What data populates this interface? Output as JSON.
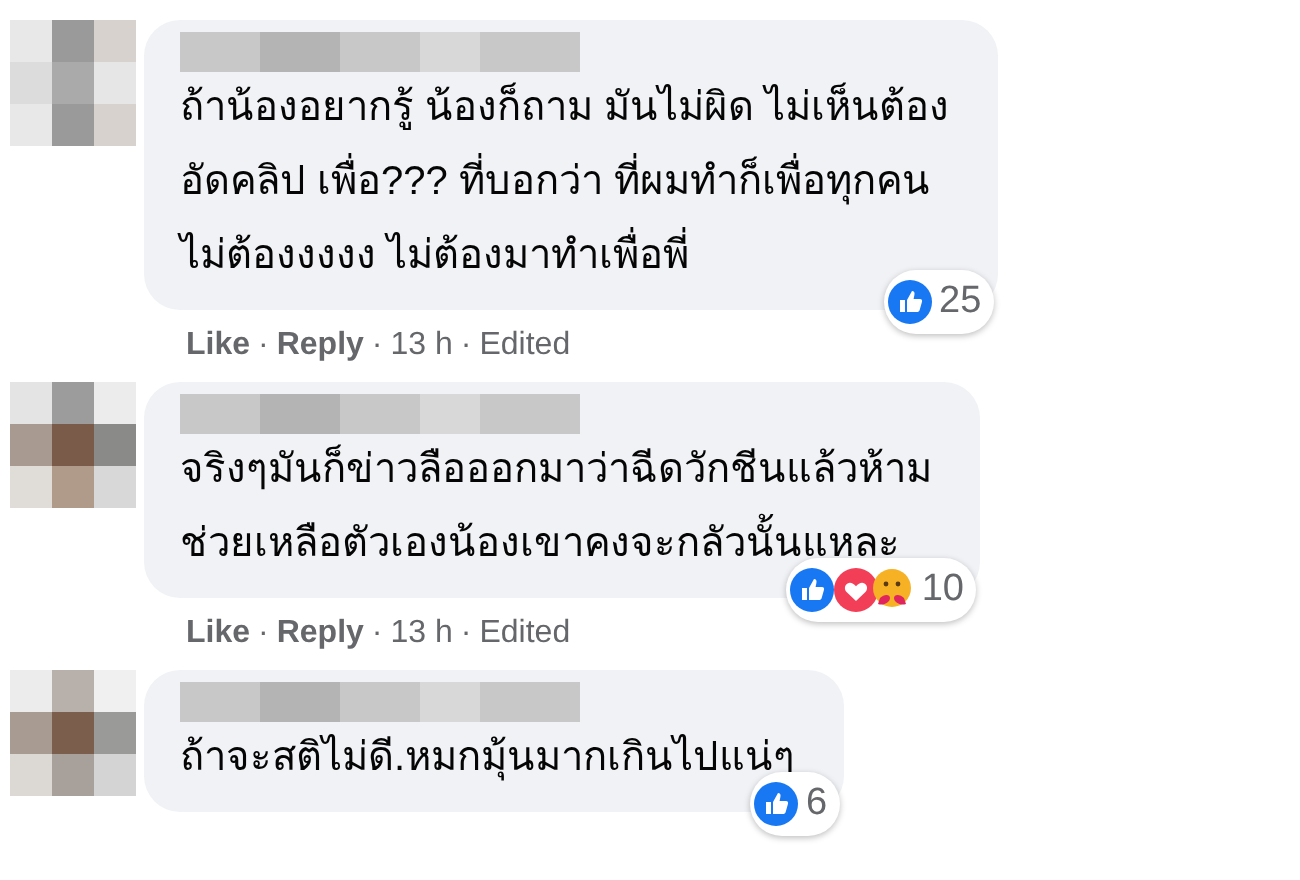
{
  "comments": [
    {
      "lines": [
        "ถ้าน้องอยากรู้ น้องก็ถาม มันไม่ผิด ไม่เห็นต้อง",
        "อัดคลิป เพื่อ??? ที่บอกว่า ที่ผมทำก็เพื่อทุกคน",
        "ไม่ต้องงงงง ไม่ต้องมาทำเพื่อพี่"
      ],
      "reactions": [
        {
          "kind": "like"
        }
      ],
      "count": "25",
      "meta": [
        {
          "kind": "link",
          "text": "Like"
        },
        {
          "kind": "sep",
          "text": "·"
        },
        {
          "kind": "link",
          "text": "Reply"
        },
        {
          "kind": "sep",
          "text": "·"
        },
        {
          "kind": "text",
          "text": "13 h"
        },
        {
          "kind": "sep",
          "text": "·"
        },
        {
          "kind": "text",
          "text": "Edited"
        }
      ]
    },
    {
      "lines": [
        "จริงๆมันก็ข่าวลือออกมาว่าฉีดวักชีนแล้วห้าม",
        "ช่วยเหลือตัวเองน้องเขาคงจะกลัวนั้นแหละ"
      ],
      "reactions": [
        {
          "kind": "like"
        },
        {
          "kind": "love"
        },
        {
          "kind": "care"
        }
      ],
      "count": "10",
      "meta": [
        {
          "kind": "link",
          "text": "Like"
        },
        {
          "kind": "sep",
          "text": "·"
        },
        {
          "kind": "link",
          "text": "Reply"
        },
        {
          "kind": "sep",
          "text": "·"
        },
        {
          "kind": "text",
          "text": "13 h"
        },
        {
          "kind": "sep",
          "text": "·"
        },
        {
          "kind": "text",
          "text": "Edited"
        }
      ]
    },
    {
      "lines": [
        "ถ้าจะสติไม่ดี.หมกมุ้นมากเกินไปแน่ๆ"
      ],
      "reactions": [
        {
          "kind": "like"
        }
      ],
      "count": "6"
    }
  ]
}
